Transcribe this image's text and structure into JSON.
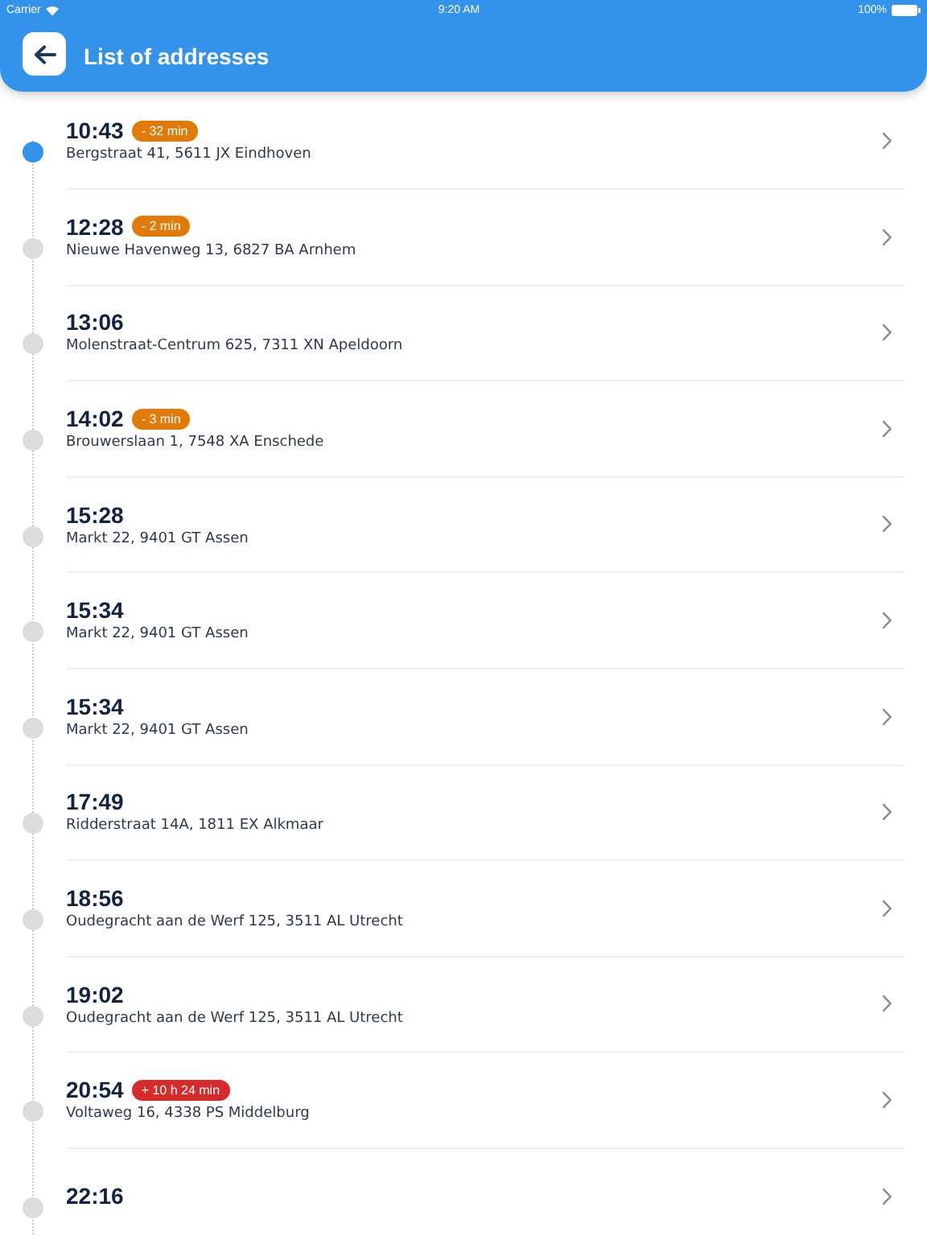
{
  "status_bar": {
    "carrier": "Carrier",
    "time": "9:20 AM",
    "battery": "100%"
  },
  "header": {
    "title": "List of addresses"
  },
  "stops": [
    {
      "time": "10:43",
      "badge": "- 32 min",
      "color": "#e07b0a",
      "address": "Bergstraat 41, 5611 JX Eindhoven",
      "current": true
    },
    {
      "time": "12:28",
      "badge": "- 2 min",
      "color": "#e07b0a",
      "address": "Nieuwe Havenweg 13, 6827 BA Arnhem",
      "current": false
    },
    {
      "time": "13:06",
      "address": "Molenstraat-Centrum 625, 7311 XN Apeldoorn",
      "current": false
    },
    {
      "time": "14:02",
      "badge": "- 3 min",
      "color": "#e07b0a",
      "address": "Brouwerslaan 1, 7548 XA Enschede",
      "current": false
    },
    {
      "time": "15:28",
      "address": "Markt 22, 9401 GT Assen",
      "current": false
    },
    {
      "time": "15:34",
      "address": "Markt 22, 9401 GT Assen",
      "current": false
    },
    {
      "time": "15:34",
      "address": "Markt 22, 9401 GT Assen",
      "current": false
    },
    {
      "time": "17:49",
      "address": "Ridderstraat 14A, 1811 EX Alkmaar",
      "current": false
    },
    {
      "time": "18:56",
      "address": "Oudegracht aan de Werf 125, 3511 AL Utrecht",
      "current": false
    },
    {
      "time": "19:02",
      "address": "Oudegracht aan de Werf 125, 3511 AL Utrecht",
      "current": false
    },
    {
      "time": "20:54",
      "badge": "+ 10 h 24 min",
      "color": "#d62b2b",
      "address": "Voltaweg 16, 4338 PS Middelburg",
      "current": false
    },
    {
      "time": "22:16",
      "current": false
    }
  ]
}
